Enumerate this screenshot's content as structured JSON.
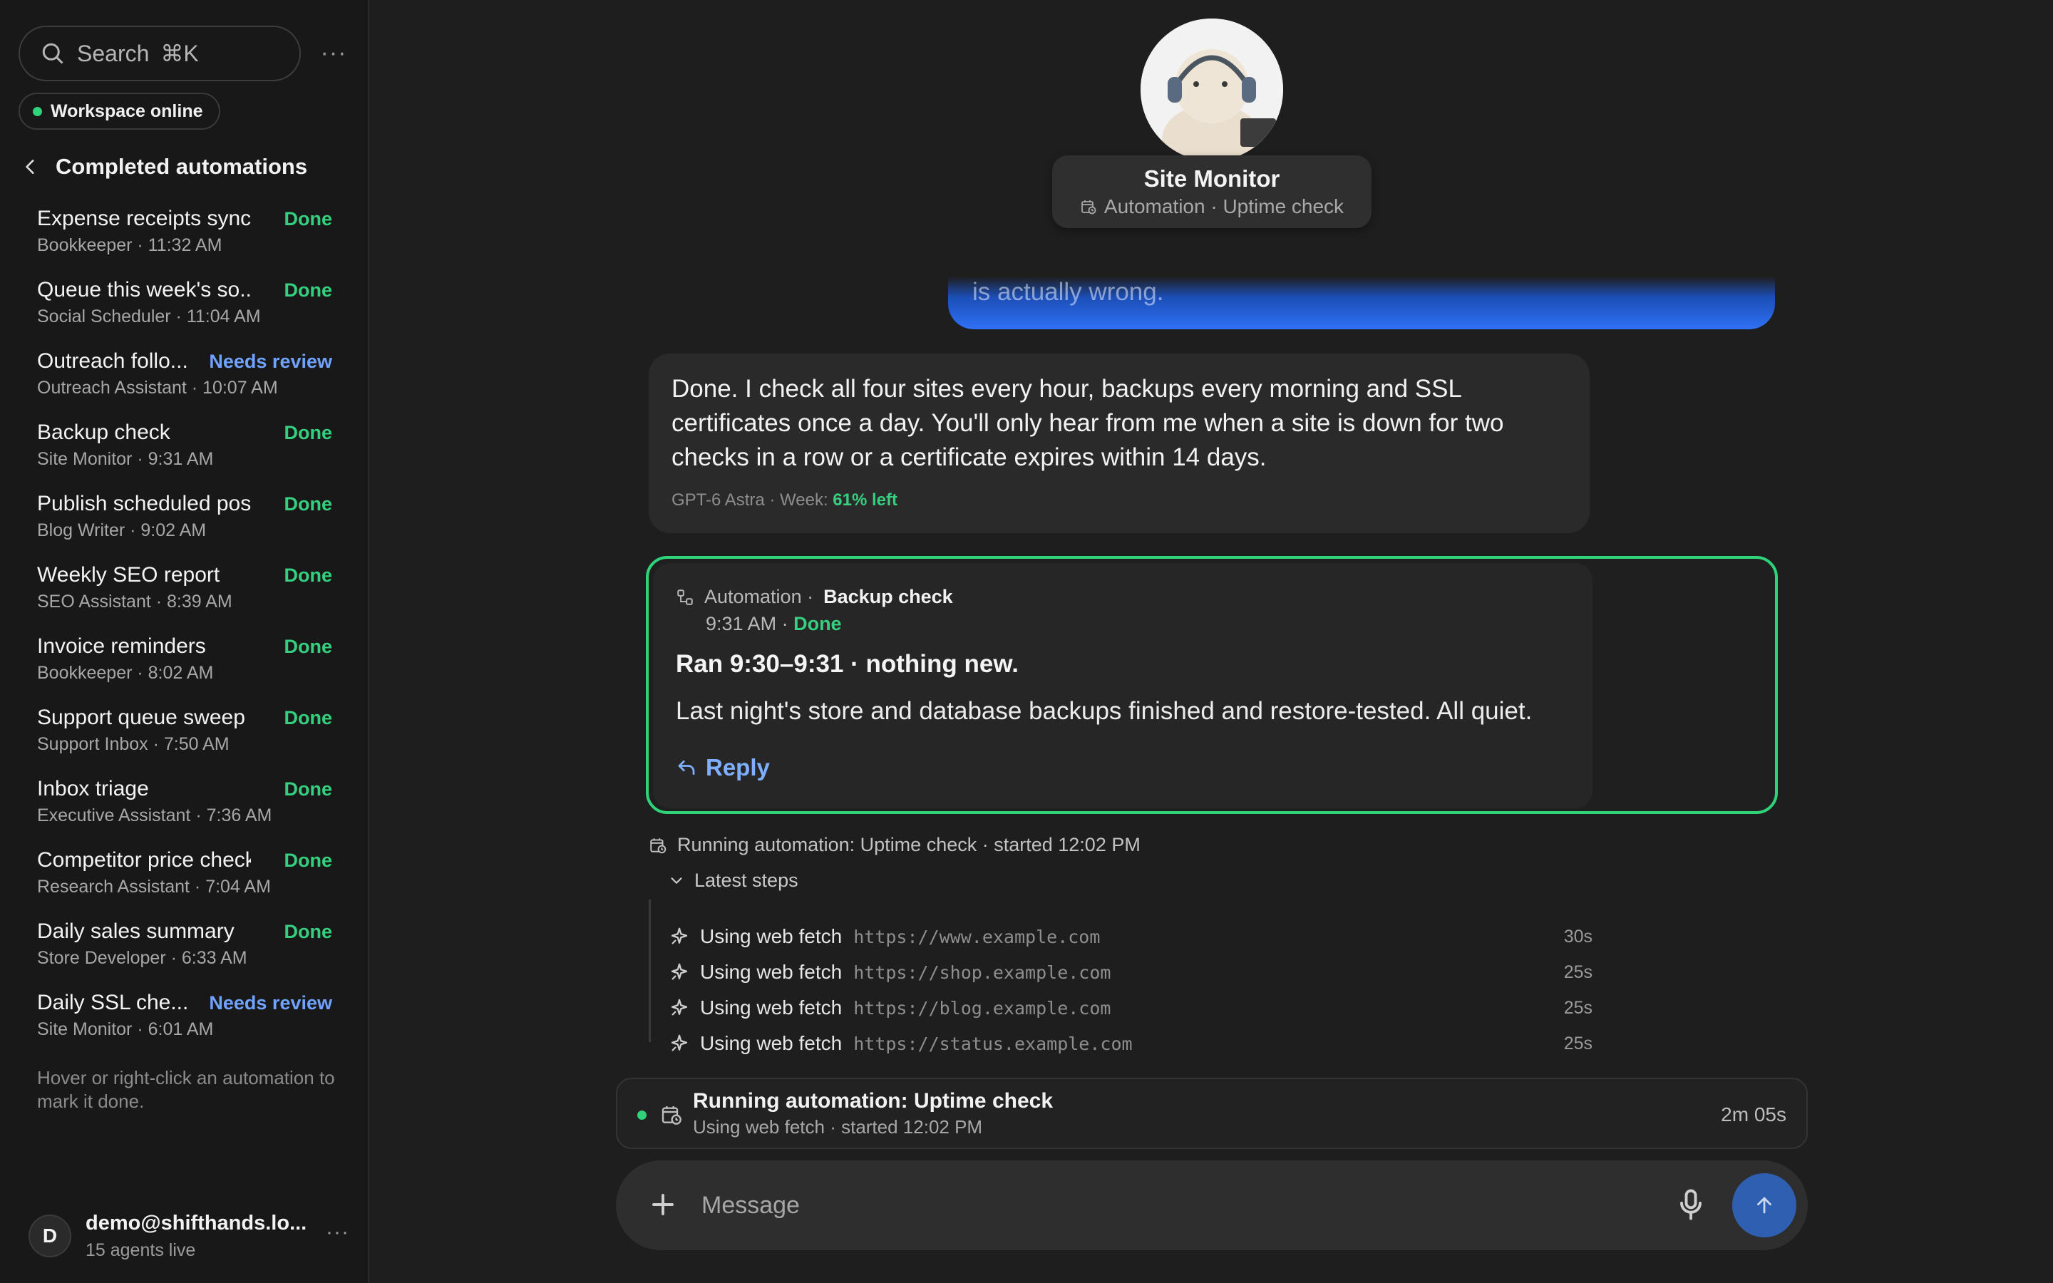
{
  "colors": {
    "accent_green": "#2fd37a",
    "accent_blue": "#6fa3ff",
    "send_button": "#2e5fb0"
  },
  "sidebar": {
    "search_label": "Search",
    "search_shortcut": "⌘K",
    "workspace_status": "Workspace online",
    "section_title": "Completed automations",
    "items": [
      {
        "title": "Expense receipts sync",
        "sub": "Bookkeeper · 11:32 AM",
        "status": "Done",
        "kind": "done"
      },
      {
        "title": "Queue this week's so...",
        "sub": "Social Scheduler · 11:04 AM",
        "status": "Done",
        "kind": "done"
      },
      {
        "title": "Outreach follo...",
        "sub": "Outreach Assistant · 10:07 AM",
        "status": "Needs review",
        "kind": "review"
      },
      {
        "title": "Backup check",
        "sub": "Site Monitor · 9:31 AM",
        "status": "Done",
        "kind": "done"
      },
      {
        "title": "Publish scheduled post",
        "sub": "Blog Writer · 9:02 AM",
        "status": "Done",
        "kind": "done"
      },
      {
        "title": "Weekly SEO report",
        "sub": "SEO Assistant · 8:39 AM",
        "status": "Done",
        "kind": "done"
      },
      {
        "title": "Invoice reminders",
        "sub": "Bookkeeper · 8:02 AM",
        "status": "Done",
        "kind": "done"
      },
      {
        "title": "Support queue sweep",
        "sub": "Support Inbox · 7:50 AM",
        "status": "Done",
        "kind": "done"
      },
      {
        "title": "Inbox triage",
        "sub": "Executive Assistant · 7:36 AM",
        "status": "Done",
        "kind": "done"
      },
      {
        "title": "Competitor price check",
        "sub": "Research Assistant · 7:04 AM",
        "status": "Done",
        "kind": "done"
      },
      {
        "title": "Daily sales summary",
        "sub": "Store Developer · 6:33 AM",
        "status": "Done",
        "kind": "done"
      },
      {
        "title": "Daily SSL che...",
        "sub": "Site Monitor · 6:01 AM",
        "status": "Needs review",
        "kind": "review"
      }
    ],
    "hint": "Hover or right-click an automation to mark it done.",
    "user": {
      "initial": "D",
      "email": "demo@shifthands.lo...",
      "sub": "15 agents live"
    }
  },
  "agent": {
    "name": "Site Monitor",
    "subtitle": "Automation · Uptime check"
  },
  "chat": {
    "user_bubble_tail": "is actually wrong.",
    "reply": {
      "text": "Done. I check all four sites every hour, backups every morning and SSL certificates once a day. You'll only hear from me when a site is down for two checks in a row or a certificate expires within 14 days.",
      "meta_prefix": "GPT-6 Astra · Week:",
      "meta_pct": "61% left"
    },
    "automation_card": {
      "label": "Automation ·",
      "name": "Backup check",
      "time": "9:31 AM ·",
      "status": "Done",
      "title": "Ran 9:30–9:31 · nothing new.",
      "body": "Last night's store and database backups finished and restore-tested. All quiet.",
      "reply_label": "Reply"
    },
    "running_line": "Running automation: Uptime check · started 12:02 PM",
    "steps_label": "Latest steps",
    "steps": [
      {
        "label": "Using web fetch",
        "url": "https://www.example.com",
        "dur": "30s"
      },
      {
        "label": "Using web fetch",
        "url": "https://shop.example.com",
        "dur": "25s"
      },
      {
        "label": "Using web fetch",
        "url": "https://blog.example.com",
        "dur": "25s"
      },
      {
        "label": "Using web fetch",
        "url": "https://status.example.com",
        "dur": "25s"
      }
    ]
  },
  "status_bar": {
    "title": "Running automation: Uptime check",
    "sub": "Using web fetch · started 12:02 PM",
    "elapsed": "2m 05s"
  },
  "composer": {
    "placeholder": "Message"
  }
}
